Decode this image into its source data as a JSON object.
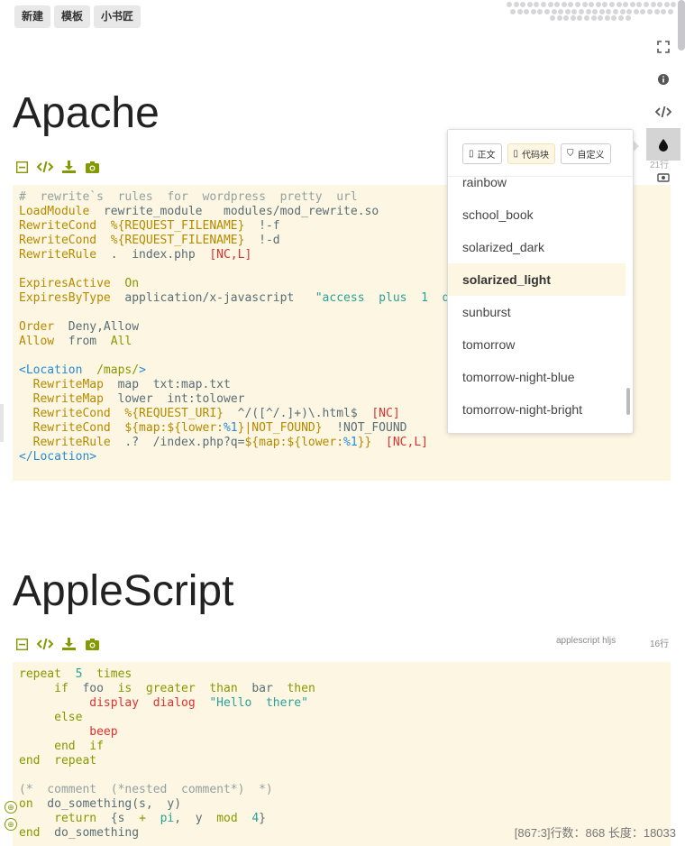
{
  "topbar": {
    "buttons": [
      "新建",
      "模板",
      "小书匠"
    ]
  },
  "sidebar": {
    "icons": [
      "fullscreen-icon",
      "info-icon",
      "code-icon",
      "drop-icon",
      "camera-icon",
      "monitor-icon",
      "grid-icon",
      "shuffle-icon",
      "menu-icon"
    ],
    "line_count": "21行"
  },
  "sections": [
    {
      "title": "Apache",
      "actions": [
        "collapse-icon",
        "code-icon",
        "download-icon",
        "camera-icon"
      ]
    },
    {
      "title": "AppleScript",
      "actions": [
        "collapse-icon",
        "code-icon",
        "download-icon",
        "camera-icon"
      ],
      "meta_lang": "applescript  hljs",
      "meta_lines": "16行"
    }
  ],
  "theme_popup": {
    "tabs": [
      "正文",
      "代码块",
      "自定义"
    ],
    "selected_tab": "代码块",
    "items": [
      "rainbow",
      "school_book",
      "solarized_dark",
      "solarized_light",
      "sunburst",
      "tomorrow",
      "tomorrow-night-blue",
      "tomorrow-night-bright"
    ],
    "selected_item": "solarized_light"
  },
  "status": "[867:3]行数：868 长度：18033",
  "colors": {
    "code_bg": "#fdf6e3",
    "accent": "#859900"
  }
}
